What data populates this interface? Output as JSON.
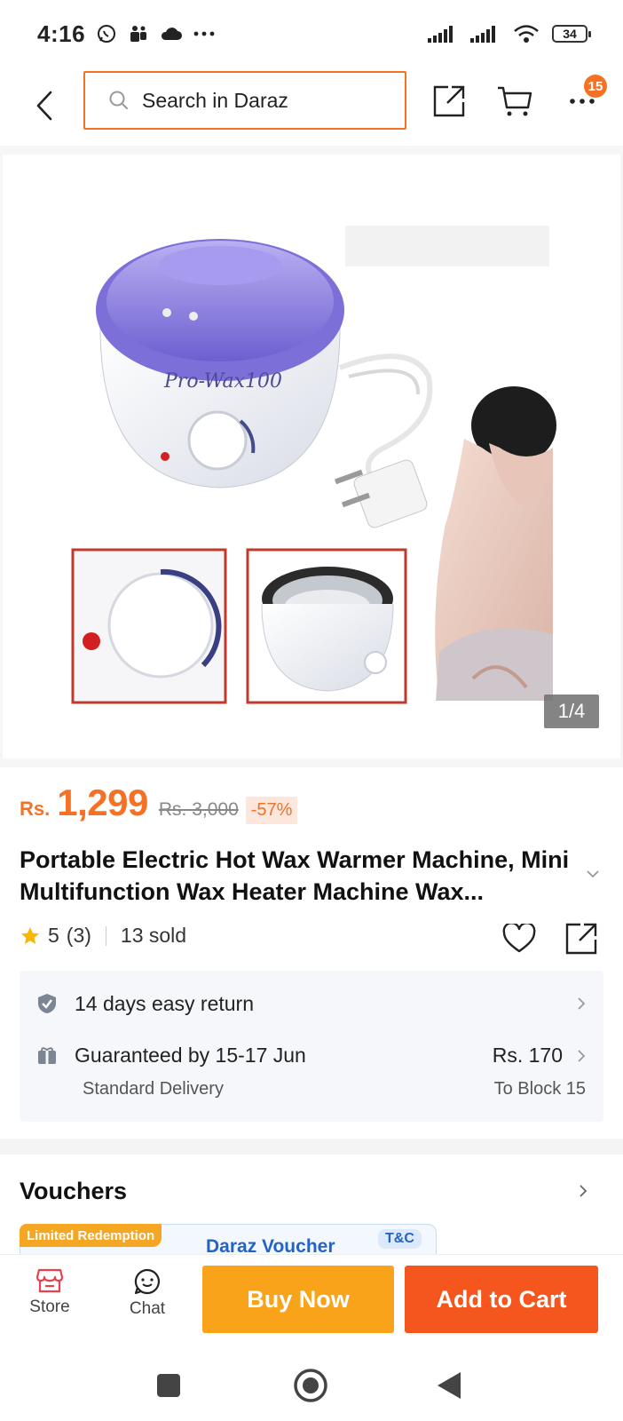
{
  "status_bar": {
    "time": "4:16",
    "battery": "34",
    "left_icons": [
      "whatsapp-icon",
      "teams-icon",
      "cloud-icon",
      "more-dots-icon"
    ],
    "right_icons": [
      "signal-icon",
      "signal-icon",
      "wifi-icon",
      "battery-icon"
    ]
  },
  "header": {
    "search_placeholder": "Search in Daraz",
    "cart_badge": "15",
    "icons": [
      "back-icon",
      "search-icon",
      "share-icon",
      "cart-icon",
      "more-icon"
    ]
  },
  "gallery": {
    "counter": "1/4",
    "product_brand_text": "Pro-Wax100"
  },
  "price": {
    "currency": "Rs.",
    "current": "1,299",
    "original": "Rs. 3,000",
    "discount": "-57%"
  },
  "product": {
    "title": "Portable Electric Hot Wax Warmer Machine, Mini Multifunction Wax Heater Machine Wax..."
  },
  "rating": {
    "score": "5",
    "count": "(3)",
    "sold": "13 sold"
  },
  "service": {
    "return_text": "14 days easy return",
    "delivery_text": "Guaranteed by 15-17 Jun",
    "delivery_type": "Standard Delivery",
    "delivery_fee": "Rs. 170",
    "delivery_location": "To Block 15"
  },
  "vouchers": {
    "title": "Vouchers",
    "badge": "Limited Redemption",
    "voucher_name": "Daraz Voucher",
    "tnc": "T&C"
  },
  "bottom_bar": {
    "store_label": "Store",
    "chat_label": "Chat",
    "buy_now": "Buy Now",
    "add_to_cart": "Add to Cart"
  },
  "colors": {
    "accent": "#f57224",
    "buy_now": "#f8a31a",
    "add_to_cart": "#f5561d",
    "voucher_blue": "#2463c6"
  }
}
